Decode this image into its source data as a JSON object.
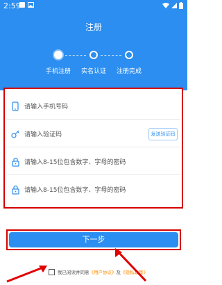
{
  "status_bar": {
    "time": "2:59"
  },
  "header": {
    "title": "注册",
    "steps": [
      {
        "label": "手机注册",
        "active": true
      },
      {
        "label": "实名认证",
        "active": false
      },
      {
        "label": "注册完成",
        "active": false
      }
    ]
  },
  "form": {
    "phone_placeholder": "请输入手机号码",
    "code_placeholder": "请输入验证码",
    "send_code_label": "发送验证码",
    "password_placeholder": "请输入8-15位包含数字、字母的密码",
    "confirm_password_placeholder": "请输入8-15位包含数字、字母的密码"
  },
  "next_button": {
    "label": "下一步"
  },
  "agreement": {
    "prefix": "我已阅读并同意",
    "user_agreement": "《用户协议》",
    "and": "及",
    "privacy_policy": "《隐私政策》"
  },
  "colors": {
    "primary": "#2b8ef0",
    "highlight": "#d40000",
    "link": "#ff8a00"
  }
}
